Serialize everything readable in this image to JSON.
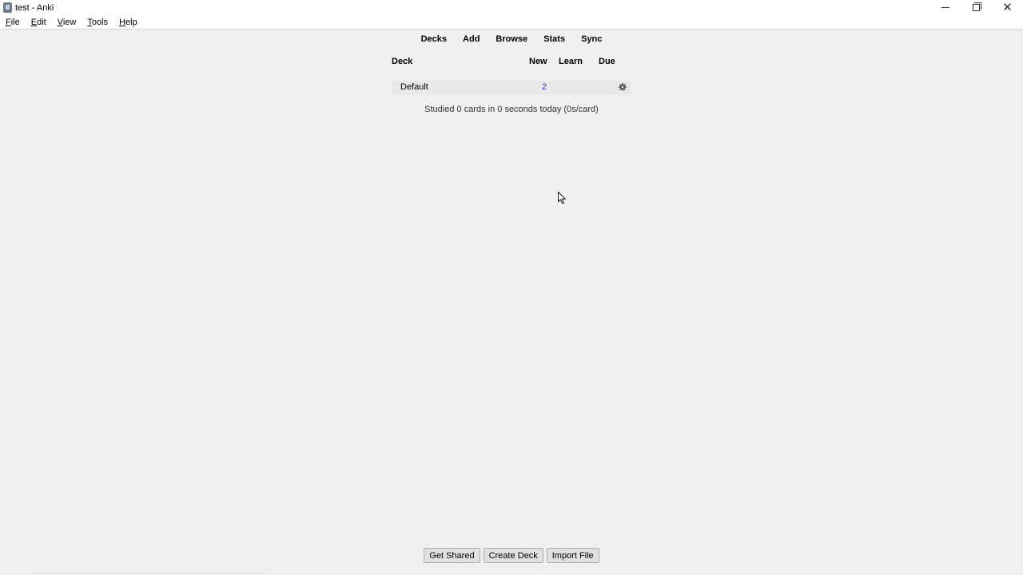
{
  "window": {
    "title": "test - Anki"
  },
  "menu": [
    {
      "label_ul": "F",
      "label_rest": "ile"
    },
    {
      "label_ul": "E",
      "label_rest": "dit"
    },
    {
      "label_ul": "V",
      "label_rest": "iew"
    },
    {
      "label_ul": "T",
      "label_rest": "ools"
    },
    {
      "label_ul": "H",
      "label_rest": "elp"
    }
  ],
  "toolbar": {
    "decks": "Decks",
    "add": "Add",
    "browse": "Browse",
    "stats": "Stats",
    "sync": "Sync"
  },
  "deck_table": {
    "headers": {
      "deck": "Deck",
      "new": "New",
      "learn": "Learn",
      "due": "Due"
    },
    "rows": [
      {
        "name": "Default",
        "new": "2",
        "learn": "",
        "due": ""
      }
    ]
  },
  "status": {
    "studied": "Studied 0 cards in 0 seconds today (0s/card)"
  },
  "bottom_buttons": {
    "get_shared": "Get Shared",
    "create_deck": "Create Deck",
    "import_file": "Import File"
  },
  "colors": {
    "new_count": "#3838c8",
    "background": "#f0f0f0"
  },
  "icons": {
    "app": "anki-icon",
    "gear": "gear-icon",
    "minimize": "minimize-icon",
    "maximize": "maximize-icon",
    "close": "close-icon"
  }
}
